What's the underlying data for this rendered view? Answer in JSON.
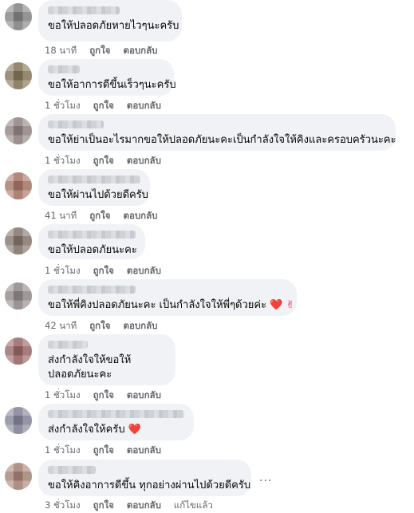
{
  "comments": [
    {
      "text": "ขอให้ปลอดภัยหายไวๆนะครับ",
      "time": "18 นาที",
      "like": "ถูกใจ",
      "reply": "ตอบกลับ",
      "avatar_color": "#8a8a8a"
    },
    {
      "text": "ขอให้อาการดีขึ้นเร็วๆนะครับ",
      "time": "1 ชั่วโมง",
      "like": "ถูกใจ",
      "reply": "ตอบกลับ",
      "avatar_color": "#8a7a5a"
    },
    {
      "text": "ขอให้ย่าเป็นอะไรมากขอให้ปลอดภัยนะคะเป็นกำลังใจให้คิงและครอบครัวนะคะ",
      "time": "1 ชั่วโมง",
      "like": "ถูกใจ",
      "reply": "ตอบกลับ",
      "avatar_color": "#9a8a8a"
    },
    {
      "text": "ขอให้ผ่านไปด้วยดีครับ",
      "time": "41 นาที",
      "like": "ถูกใจ",
      "reply": "ตอบกลับ",
      "avatar_color": "#b07a6a"
    },
    {
      "text": "ขอให้ปลอดภัยนะคะ",
      "time": "1 ชั่วโมง",
      "like": "ถูกใจ",
      "reply": "ตอบกลับ",
      "avatar_color": "#8a7a70"
    },
    {
      "text": "ขอให้พี่คิงปลอดภัยนะคะ เป็นกำลังใจให้พี่ๆด้วยค่ะ",
      "emoji": "❤️ ✌",
      "time": "42 นาที",
      "like": "ถูกใจ",
      "reply": "ตอบกลับ",
      "avatar_color": "#9a9090"
    },
    {
      "text": "ส่งกำลังใจให้ขอให้ปลอดภัยนะคะ",
      "time": "1 ชั่วโมง",
      "like": "ถูกใจ",
      "reply": "ตอบกลับ",
      "avatar_color": "#a06a6a"
    },
    {
      "text": "ส่งกำลังใจให้ครับ",
      "emoji": "❤️",
      "time": "1 ชั่วโมง",
      "like": "ถูกใจ",
      "reply": "ตอบกลับ",
      "avatar_color": "#8a8aa0"
    },
    {
      "text": "ขอให้คิงอาการดีขึ้น ทุกอย่างผ่านไปด้วยดีครับ",
      "time": "3 ชั่วโมง",
      "like": "ถูกใจ",
      "reply": "ตอบกลับ",
      "extra": "แก้ไขแล้ว",
      "avatar_color": "#b08a7a"
    }
  ],
  "more_icon": "..."
}
